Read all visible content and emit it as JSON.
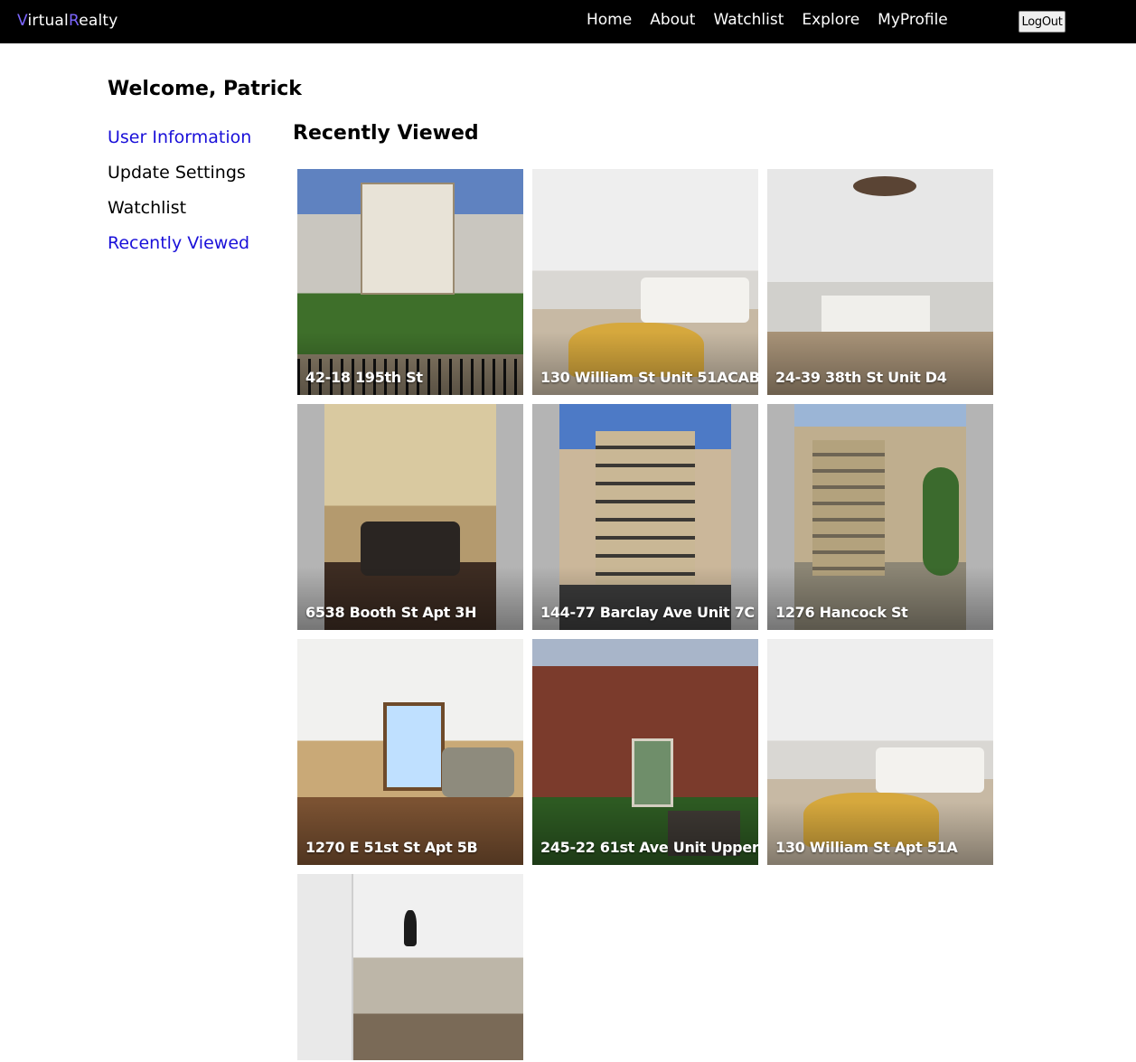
{
  "brand": {
    "first_letter": "V",
    "first_rest": "irtual",
    "second_letter": "R",
    "second_rest": "ealty"
  },
  "nav": {
    "items": [
      "Home",
      "About",
      "Watchlist",
      "Explore",
      "MyProfile"
    ],
    "logout_label": "LogOut"
  },
  "welcome": "Welcome, Patrick",
  "sidebar": {
    "items": [
      {
        "label": "User Information",
        "active": true
      },
      {
        "label": "Update Settings",
        "active": false
      },
      {
        "label": "Watchlist",
        "active": false
      },
      {
        "label": "Recently Viewed",
        "active": true
      }
    ]
  },
  "main": {
    "title": "Recently Viewed",
    "listings": [
      {
        "address": "42-18 195th St",
        "photo": "house-exterior"
      },
      {
        "address": "130 William St Unit 51ACAB",
        "photo": "living-room"
      },
      {
        "address": "24-39 38th St Unit D4",
        "photo": "kitchen"
      },
      {
        "address": "6538 Booth St Apt 3H",
        "photo": "living-room-dark"
      },
      {
        "address": "144-77 Barclay Ave Unit 7C",
        "photo": "apartment-tower"
      },
      {
        "address": "1276 Hancock St",
        "photo": "brownstone"
      },
      {
        "address": "1270 E 51st St Apt 5B",
        "photo": "apartment-interior"
      },
      {
        "address": "245-22 61st Ave Unit Upper",
        "photo": "brick-building"
      },
      {
        "address": "130 William St Apt 51A",
        "photo": "living-room"
      },
      {
        "address": "",
        "photo": "kitchen-stairs"
      }
    ]
  },
  "colors": {
    "accent": "#7c66ff",
    "link_active": "#1a10d9",
    "topbar": "#000000"
  }
}
